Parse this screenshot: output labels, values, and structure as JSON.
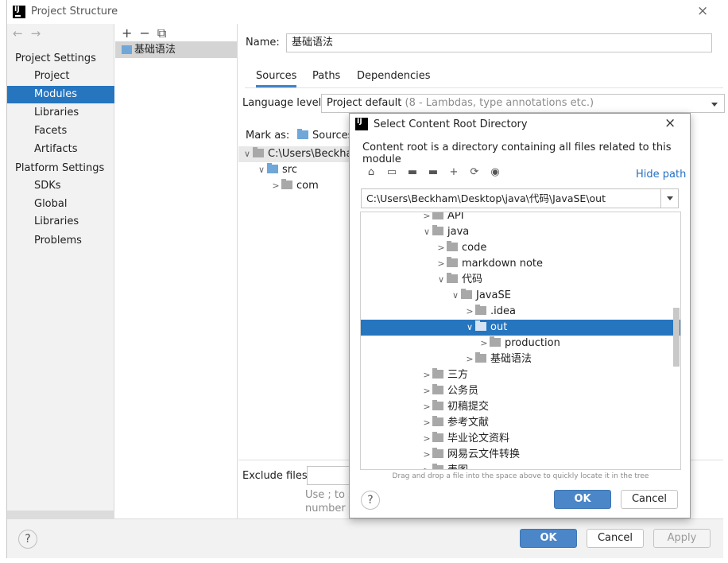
{
  "window": {
    "title": "Project Structure",
    "close": "×"
  },
  "sidebar": {
    "back": "←",
    "forward": "→",
    "group1": "Project Settings",
    "group2": "Platform Settings",
    "items": [
      "Project",
      "Modules",
      "Libraries",
      "Facets",
      "Artifacts"
    ],
    "platform_items": [
      "SDKs",
      "Global Libraries"
    ],
    "problems": "Problems",
    "selected": "Modules"
  },
  "modules": {
    "toolbar": [
      "+",
      "−",
      "⧉"
    ],
    "items": [
      "基础语法"
    ]
  },
  "module_settings": {
    "name_label": "Name:",
    "name_value": "基础语法",
    "tabs": [
      "Sources",
      "Paths",
      "Dependencies"
    ],
    "active_tab": "Sources",
    "language_label": "Language level:",
    "language_value": "Project default",
    "language_hint": "(8 - Lambdas, type annotations etc.)",
    "mark_as": "Mark as:",
    "mark_sources": "Sources",
    "content_tree": [
      {
        "label": "C:\\Users\\Beckham",
        "chevron": "∨"
      },
      {
        "label": "src",
        "chevron": "∨"
      },
      {
        "label": "com",
        "chevron": ">"
      }
    ],
    "exclude_label": "Exclude files:",
    "exclude_hint_1": "Use ; to s",
    "exclude_hint_2": "number o"
  },
  "bottom": {
    "help": "?",
    "ok": "OK",
    "cancel": "Cancel",
    "apply": "Apply"
  },
  "dialog": {
    "title": "Select Content Root Directory",
    "close": "×",
    "description": "Content root is a directory containing all files related to this module",
    "toolbar_icons": [
      "home-icon",
      "desktop-icon",
      "project-folder-icon",
      "module-folder-icon",
      "new-folder-icon",
      "refresh-icon",
      "show-hidden-icon"
    ],
    "hide_path": "Hide path",
    "path": "C:\\Users\\Beckham\\Desktop\\java\\代码\\JavaSE\\out",
    "tree": [
      {
        "label": "API",
        "chevron": ">",
        "level": 0
      },
      {
        "label": "java",
        "chevron": "∨",
        "level": 0
      },
      {
        "label": "code",
        "chevron": ">",
        "level": 1
      },
      {
        "label": "markdown note",
        "chevron": ">",
        "level": 1
      },
      {
        "label": "代码",
        "chevron": "∨",
        "level": 1
      },
      {
        "label": "JavaSE",
        "chevron": "∨",
        "level": 2
      },
      {
        "label": ".idea",
        "chevron": ">",
        "level": 3
      },
      {
        "label": "out",
        "chevron": "∨",
        "level": 3,
        "selected": true
      },
      {
        "label": "production",
        "chevron": ">",
        "level": 4
      },
      {
        "label": "基础语法",
        "chevron": ">",
        "level": 3
      },
      {
        "label": "三方",
        "chevron": ">",
        "level": 0
      },
      {
        "label": "公务员",
        "chevron": ">",
        "level": 0
      },
      {
        "label": "初稿提交",
        "chevron": ">",
        "level": 0
      },
      {
        "label": "参考文献",
        "chevron": ">",
        "level": 0
      },
      {
        "label": "毕业论文资料",
        "chevron": ">",
        "level": 0
      },
      {
        "label": "网易云文件转换",
        "chevron": ">",
        "level": 0
      },
      {
        "label": "表图",
        "chevron": ">",
        "level": 0
      }
    ],
    "drag_hint": "Drag and drop a file into the space above to quickly locate it in the tree",
    "help": "?",
    "ok": "OK",
    "cancel": "Cancel"
  },
  "colors": {
    "selection": "#2675bf",
    "primary_button": "#4a86c8",
    "link": "#2470c4"
  }
}
